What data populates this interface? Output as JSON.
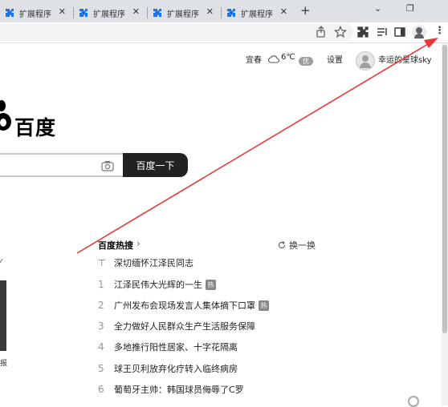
{
  "tabs": [
    {
      "label": "扩展程序",
      "close": "✕"
    },
    {
      "label": "扩展程序",
      "close": "✕"
    },
    {
      "label": "扩展程序",
      "close": "✕"
    },
    {
      "label": "扩展程序",
      "close": "✕"
    }
  ],
  "tabstrip": {
    "new_tab": "+",
    "minimize": "⌄",
    "restore": "❐"
  },
  "toolbar": {
    "menu": "⋮"
  },
  "header": {
    "weather_city": "宜春",
    "weather_temp": "6℃",
    "weather_badge": "优",
    "settings": "设置",
    "username": "幸运的星球sky"
  },
  "logo": {
    "text": "百度"
  },
  "search": {
    "value": "",
    "button_label": "百度一下"
  },
  "hot": {
    "title": "百度热搜",
    "chevron": "›",
    "refresh_label": "换一换",
    "items": [
      {
        "rank": "⊤",
        "text": "深切缅怀江泽民同志",
        "badge": ""
      },
      {
        "rank": "1",
        "text": "江泽民伟大光辉的一生",
        "badge": "热"
      },
      {
        "rank": "2",
        "text": "广州发布会现场发言人集体摘下口罩",
        "badge": "热"
      },
      {
        "rank": "3",
        "text": "全力做好人民群众生产生活服务保障",
        "badge": ""
      },
      {
        "rank": "4",
        "text": "多地推行阳性居家、十字花隔离",
        "badge": ""
      },
      {
        "rank": "5",
        "text": "球王贝利放弃化疗转入临终病房",
        "badge": ""
      },
      {
        "rank": "6",
        "text": "葡萄牙主帅：韩国球员侮辱了C罗",
        "badge": ""
      }
    ]
  },
  "left_fragments": {
    "top": "⁄",
    "bottom": "报"
  },
  "colors": {
    "tabstrip": "#dee1e6",
    "search_button": "#222222",
    "arrow": "#e53935",
    "tab_icon": "#1a73e8"
  }
}
